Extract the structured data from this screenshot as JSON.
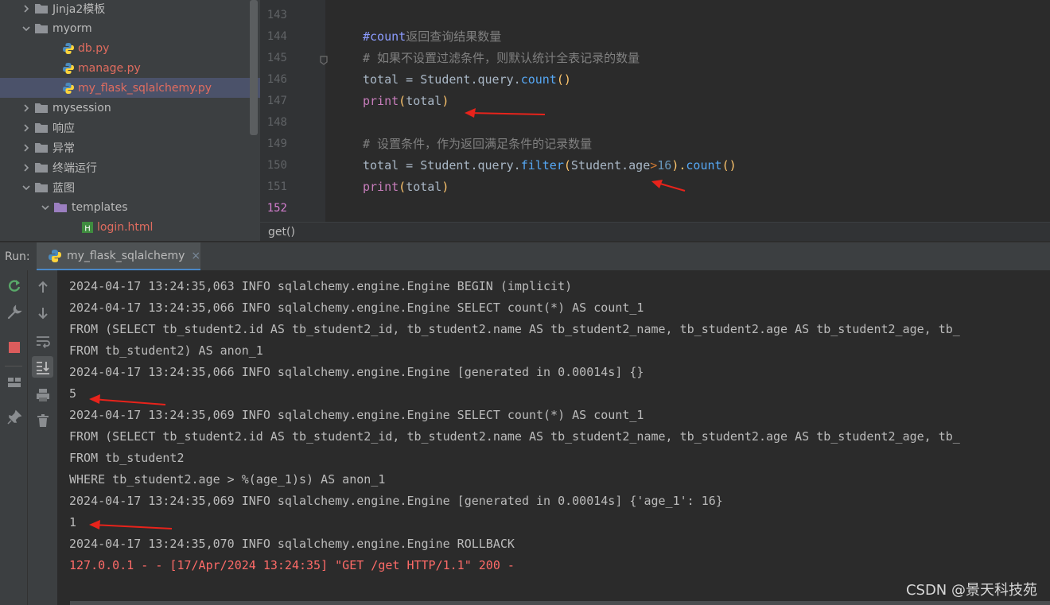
{
  "tree": {
    "items": [
      {
        "label": "Jinja2模板",
        "type": "folder",
        "expanded": false,
        "depth": 1,
        "color": "normal"
      },
      {
        "label": "myorm",
        "type": "folder",
        "expanded": true,
        "depth": 1,
        "color": "normal"
      },
      {
        "label": "db.py",
        "type": "py",
        "depth": 2,
        "color": "red"
      },
      {
        "label": "manage.py",
        "type": "py",
        "depth": 2,
        "color": "red"
      },
      {
        "label": "my_flask_sqlalchemy.py",
        "type": "py",
        "depth": 2,
        "color": "red",
        "selected": true
      },
      {
        "label": "mysession",
        "type": "folder",
        "expanded": false,
        "depth": 1,
        "color": "normal"
      },
      {
        "label": "响应",
        "type": "folder",
        "expanded": false,
        "depth": 1,
        "color": "normal"
      },
      {
        "label": "异常",
        "type": "folder",
        "expanded": false,
        "depth": 1,
        "color": "normal"
      },
      {
        "label": "终端运行",
        "type": "folder",
        "expanded": false,
        "depth": 1,
        "color": "normal"
      },
      {
        "label": "蓝图",
        "type": "folder",
        "expanded": true,
        "depth": 1,
        "color": "normal"
      },
      {
        "label": "templates",
        "type": "folder",
        "expanded": true,
        "depth": 2,
        "color": "normal"
      },
      {
        "label": "login.html",
        "type": "html",
        "depth": 3,
        "color": "red"
      }
    ]
  },
  "editor": {
    "line_numbers": [
      "143",
      "144",
      "145",
      "146",
      "147",
      "148",
      "149",
      "150",
      "151",
      "152"
    ],
    "current_line": "152",
    "lines": [
      [],
      [
        {
          "t": "#count",
          "c": "doc"
        },
        {
          "t": "返回查询结果数量",
          "c": "cmt"
        }
      ],
      [
        {
          "t": "# 如果不设置过滤条件，则默认统计全表记录的数量",
          "c": "cmt"
        }
      ],
      [
        {
          "t": "total = Student.query.",
          "c": ""
        },
        {
          "t": "count",
          "c": "cnt"
        },
        {
          "t": "()",
          "c": "fn"
        }
      ],
      [
        {
          "t": "print",
          "c": "prn"
        },
        {
          "t": "(",
          "c": "fn"
        },
        {
          "t": "total",
          "c": ""
        },
        {
          "t": ")",
          "c": "fn"
        }
      ],
      [],
      [
        {
          "t": "# 设置条件，作为返回满足条件的记录数量",
          "c": "cmt"
        }
      ],
      [
        {
          "t": "total = Student.query.",
          "c": ""
        },
        {
          "t": "filter",
          "c": "cnt"
        },
        {
          "t": "(",
          "c": "fn"
        },
        {
          "t": "Student.age",
          "c": ""
        },
        {
          "t": ">",
          "c": "kw"
        },
        {
          "t": "16",
          "c": "num"
        },
        {
          "t": ").",
          "c": "fn"
        },
        {
          "t": "count",
          "c": "cnt"
        },
        {
          "t": "()",
          "c": "fn"
        }
      ],
      [
        {
          "t": "print",
          "c": "prn"
        },
        {
          "t": "(",
          "c": "fn"
        },
        {
          "t": "total",
          "c": ""
        },
        {
          "t": ")",
          "c": "fn"
        }
      ],
      []
    ],
    "breadcrumb": "get()"
  },
  "run": {
    "label": "Run:",
    "tab_label": "my_flask_sqlalchemy",
    "tab_close": "×",
    "console": [
      {
        "text": "2024-04-17 13:24:35,063 INFO sqlalchemy.engine.Engine BEGIN (implicit)",
        "err": false
      },
      {
        "text": "2024-04-17 13:24:35,066 INFO sqlalchemy.engine.Engine SELECT count(*) AS count_1",
        "err": false
      },
      {
        "text": "FROM (SELECT tb_student2.id AS tb_student2_id, tb_student2.name AS tb_student2_name, tb_student2.age AS tb_student2_age, tb_",
        "err": false
      },
      {
        "text": "FROM tb_student2) AS anon_1",
        "err": false
      },
      {
        "text": "2024-04-17 13:24:35,066 INFO sqlalchemy.engine.Engine [generated in 0.00014s] {}",
        "err": false
      },
      {
        "text": "5",
        "err": false
      },
      {
        "text": "2024-04-17 13:24:35,069 INFO sqlalchemy.engine.Engine SELECT count(*) AS count_1",
        "err": false
      },
      {
        "text": "FROM (SELECT tb_student2.id AS tb_student2_id, tb_student2.name AS tb_student2_name, tb_student2.age AS tb_student2_age, tb_",
        "err": false
      },
      {
        "text": "FROM tb_student2",
        "err": false
      },
      {
        "text": "WHERE tb_student2.age > %(age_1)s) AS anon_1",
        "err": false
      },
      {
        "text": "2024-04-17 13:24:35,069 INFO sqlalchemy.engine.Engine [generated in 0.00014s] {'age_1': 16}",
        "err": false
      },
      {
        "text": "1",
        "err": false
      },
      {
        "text": "2024-04-17 13:24:35,070 INFO sqlalchemy.engine.Engine ROLLBACK",
        "err": false
      },
      {
        "text": "127.0.0.1 - - [17/Apr/2024 13:24:35] \"GET /get HTTP/1.1\" 200 -",
        "err": true
      }
    ]
  },
  "watermark": "CSDN @景天科技苑",
  "colors": {
    "accent": "#4a88c7",
    "annotation_arrow": "#e8231b",
    "error_text": "#ff6b68",
    "file_modified": "#e06c5f"
  }
}
